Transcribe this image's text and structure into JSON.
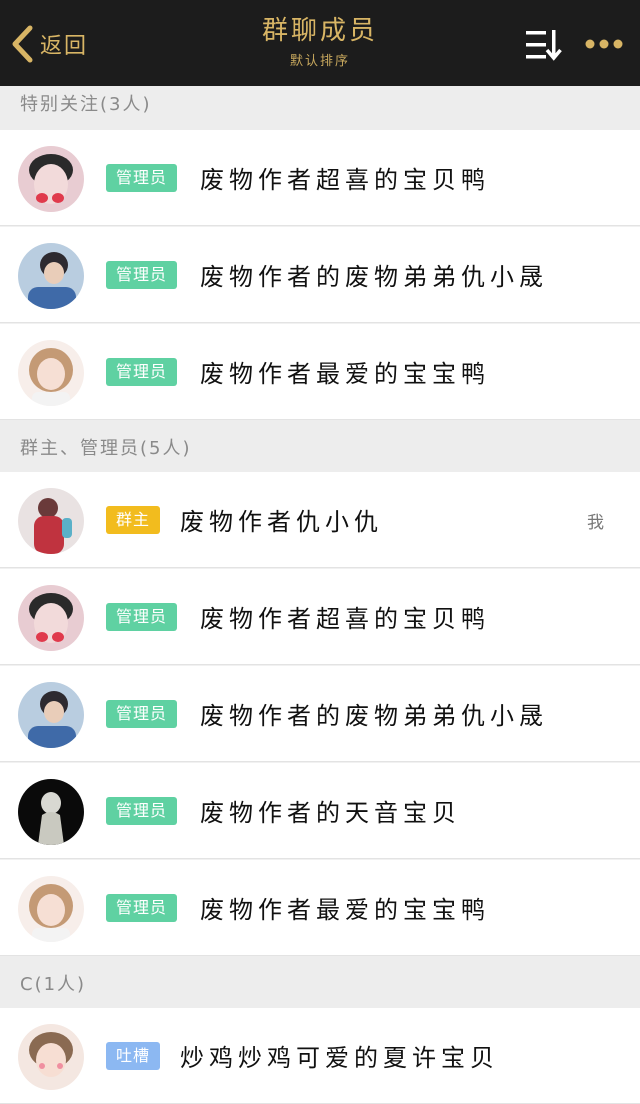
{
  "header": {
    "back_label": "返回",
    "title": "群聊成员",
    "subtitle": "默认排序",
    "accent_color": "#d8b565",
    "background_color": "#1c1c1c"
  },
  "sections": [
    {
      "title": "特别关注(3人)",
      "members": [
        {
          "role": "管理员",
          "name": "废物作者超喜的宝贝鸭"
        },
        {
          "role": "管理员",
          "name": "废物作者的废物弟弟仇小晟"
        },
        {
          "role": "管理员",
          "name": "废物作者最爱的宝宝鸭"
        }
      ]
    },
    {
      "title": "群主、管理员(5人)",
      "members": [
        {
          "role": "群主",
          "name": "废物作者仇小仇",
          "tag": "我"
        },
        {
          "role": "管理员",
          "name": "废物作者超喜的宝贝鸭"
        },
        {
          "role": "管理员",
          "name": "废物作者的废物弟弟仇小晟"
        },
        {
          "role": "管理员",
          "name": "废物作者的天音宝贝"
        },
        {
          "role": "管理员",
          "name": "废物作者最爱的宝宝鸭"
        }
      ]
    },
    {
      "title": "C(1人)",
      "members": [
        {
          "role": "吐槽",
          "name": "炒鸡炒鸡可爱的夏许宝贝"
        }
      ]
    }
  ],
  "badge_colors": {
    "admin": "#5fd1a2",
    "owner": "#f2bc1e",
    "roast": "#8cb8f2"
  },
  "icons": [
    "chevron-left-icon",
    "sort-icon",
    "more-icon"
  ]
}
